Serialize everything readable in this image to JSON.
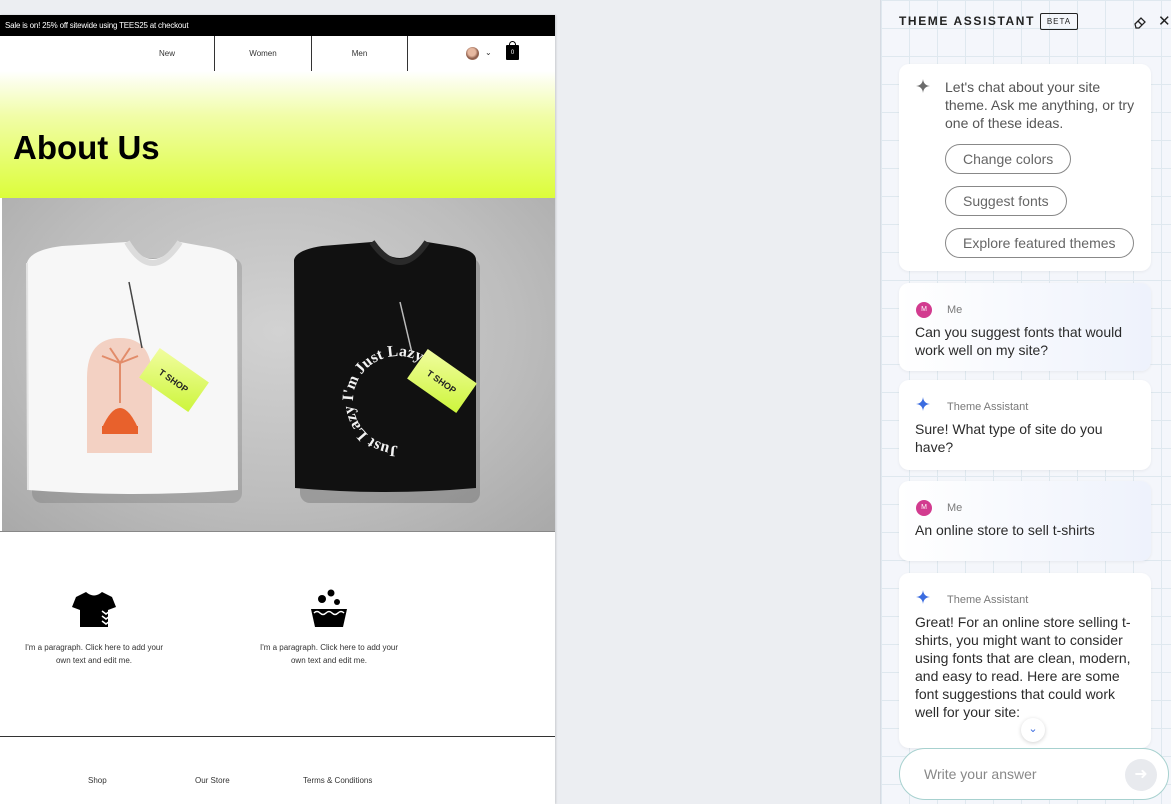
{
  "site": {
    "promo_text": "Sale is on! 25% off sitewide using TEES25 at checkout",
    "nav": {
      "new": "New",
      "women": "Women",
      "men": "Men"
    },
    "cart_count": "0",
    "hero_title": "About Us",
    "features": [
      {
        "icon": "tshirt-icon",
        "text": "I'm a paragraph. Click here to add your own text and edit me."
      },
      {
        "icon": "wash-icon",
        "text": "I'm a paragraph. Click here to add your own text and edit me."
      }
    ],
    "footer": {
      "shop": "Shop",
      "store": "Our Store",
      "terms": "Terms & Conditions"
    },
    "photo": {
      "tag_text": "T SHOP",
      "print_text": "Just Lazy I'm Just Lazy"
    }
  },
  "assistant": {
    "title": "THEME ASSISTANT",
    "badge": "BETA",
    "welcome": "Let's chat about your site theme. Ask me anything, or try one of these ideas.",
    "suggestions": [
      "Change colors",
      "Suggest fonts",
      "Explore featured themes"
    ],
    "messages": [
      {
        "author": "Me",
        "avatar_letter": "M",
        "text": "Can you suggest fonts that would work well on my site?"
      },
      {
        "author": "Theme Assistant",
        "text": "Sure! What type of site do you have?"
      },
      {
        "author": "Me",
        "avatar_letter": "M",
        "text": "An online store to sell t-shirts"
      },
      {
        "author": "Theme Assistant",
        "text": "Great! For an online store selling t-shirts, you might want to consider using fonts that are clean, modern, and easy to read. Here are some font suggestions that could work well for your site:"
      }
    ],
    "input_placeholder": "Write your answer"
  },
  "colors": {
    "hero_accent": "#dcfd3a",
    "user_avatar": "#d23b8f",
    "assistant_spark": "#3b6ce0"
  }
}
